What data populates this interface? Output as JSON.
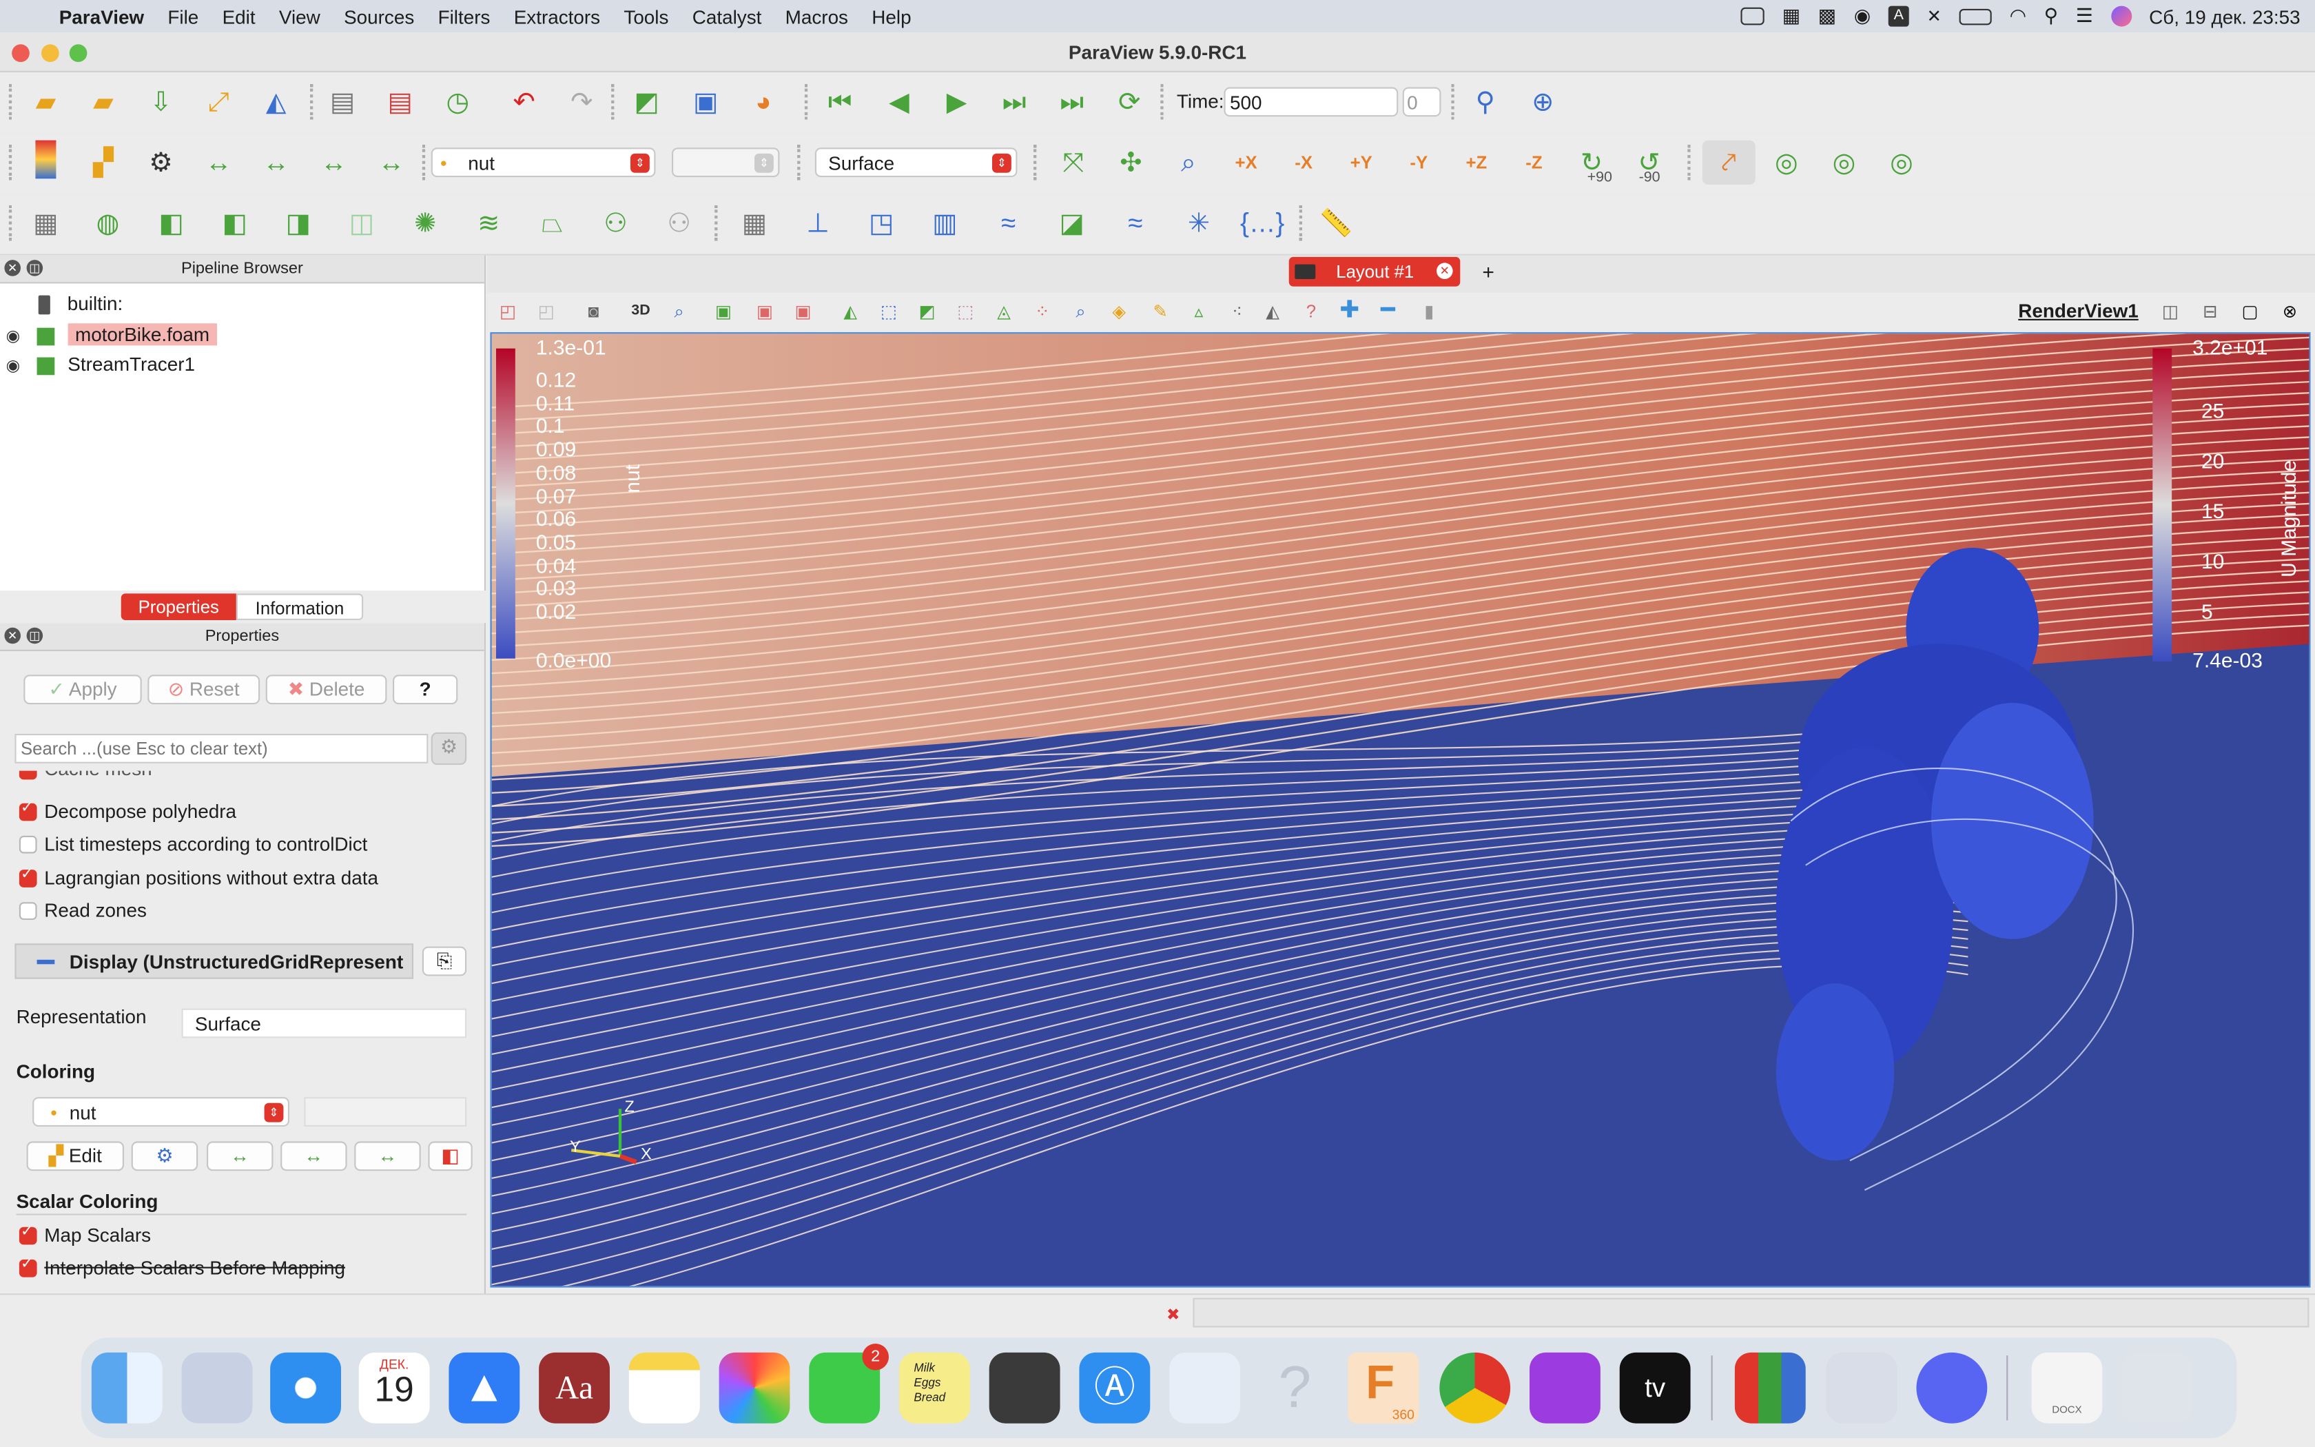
{
  "menubar": {
    "app_name": "ParaView",
    "items": [
      "File",
      "Edit",
      "View",
      "Sources",
      "Filters",
      "Extractors",
      "Tools",
      "Catalyst",
      "Macros",
      "Help"
    ],
    "clock": "Сб, 19 дек.  23:53"
  },
  "window": {
    "title": "ParaView 5.9.0-RC1"
  },
  "toolbar": {
    "time_label": "Time:",
    "time_value": "500",
    "time_index": "0",
    "color_by": "nut",
    "representation": "Surface",
    "rot_plus": "+90",
    "rot_minus": "-90",
    "axis_labels": [
      "+X",
      "-X",
      "+Y",
      "-Y",
      "+Z",
      "-Z"
    ]
  },
  "pipeline": {
    "title": "Pipeline Browser",
    "items": [
      "builtin:",
      "motorBike.foam",
      "StreamTracer1"
    ]
  },
  "tabs": {
    "properties": "Properties",
    "information": "Information"
  },
  "properties": {
    "title": "Properties",
    "apply": "Apply",
    "reset": "Reset",
    "delete": "Delete",
    "help": "?",
    "search_placeholder": "Search ...(use Esc to clear text)",
    "cut_item": "Cache mesh",
    "checkboxes": [
      {
        "label": "Decompose polyhedra",
        "checked": true
      },
      {
        "label": "List timesteps according to controlDict",
        "checked": false
      },
      {
        "label": "Lagrangian positions without extra data",
        "checked": true
      },
      {
        "label": "Read zones",
        "checked": false
      }
    ],
    "display_section": "Display (UnstructuredGridRepresent",
    "representation_label": "Representation",
    "representation_value": "Surface",
    "coloring_section": "Coloring",
    "coloring_value": "nut",
    "edit_label": "Edit",
    "scalar_section": "Scalar Coloring",
    "map_scalars": "Map Scalars",
    "interpolate": "Interpolate Scalars Before Mapping"
  },
  "layout": {
    "tab": "Layout #1",
    "add": "+",
    "view_name": "RenderView1",
    "mode_3d": "3D"
  },
  "legend_left": {
    "title": "nut",
    "max_label": "1.3e-01",
    "min_label": "0.0e+00",
    "ticks": [
      "0.12",
      "0.11",
      "0.1",
      "0.09",
      "0.08",
      "0.07",
      "0.06",
      "0.05",
      "0.04",
      "0.03",
      "0.02"
    ]
  },
  "legend_right": {
    "title": "U Magnitude",
    "max_label": "3.2e+01",
    "min_label": "7.4e-03",
    "ticks": [
      "25",
      "20",
      "15",
      "10",
      "5"
    ]
  },
  "axes": {
    "z": "Z",
    "y": "Y",
    "x": "X"
  },
  "dock": {
    "calendar_month": "ДЕК.",
    "calendar_day": "19",
    "messages_badge": "2",
    "note_lines": [
      "Milk",
      "Eggs",
      "Bread"
    ],
    "fusion_label": "360",
    "docx_label": "DOCX",
    "dictionary_label": "Aa",
    "tv_label": "tv",
    "unknown_label": "?"
  },
  "colors": {
    "accent": "#e0352b",
    "render_bg": "#35479a",
    "select_blue": "#4a8ad8"
  }
}
